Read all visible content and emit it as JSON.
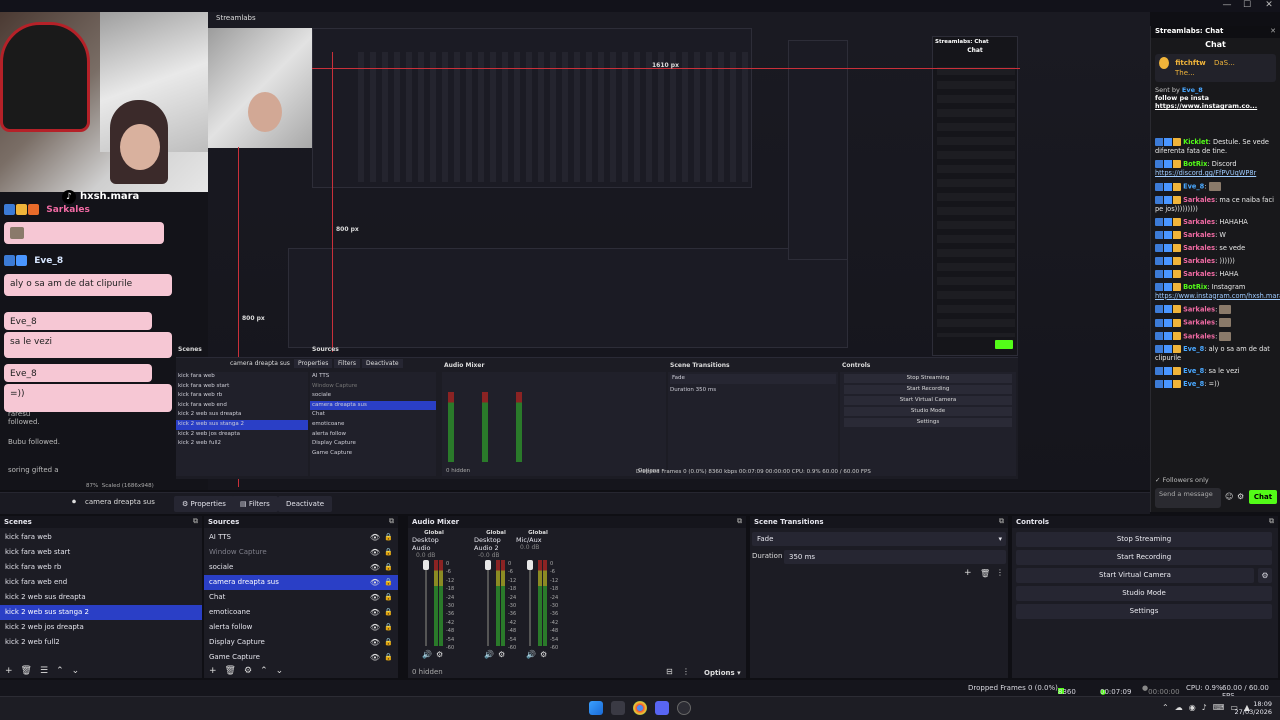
{
  "window": {
    "minimize": "—",
    "maximize": "☐",
    "close": "✕"
  },
  "preview": {
    "tiktok_handle": "hxsh.mara",
    "overlay_bubbles": [
      {
        "user": "Sarkales",
        "text": ""
      },
      {
        "user": "Eve_8",
        "text": "aly o sa am de dat clipurile"
      },
      {
        "user": "Eve_8",
        "text": "sa le vezi"
      },
      {
        "user": "Eve_8",
        "text": "=))"
      }
    ],
    "follow_alerts": [
      "raresu followed.",
      "Bubu followed.",
      "soring gifted a"
    ],
    "nested_title": "Streamlabs",
    "nested_px_a": "1610 px",
    "nested_px_b": "800 px",
    "nested_px_c": "800 px",
    "nested_chat_title": "Streamlabs: Chat",
    "nested_chat_sub": "Chat",
    "mini_scenes": [
      "kick fara web",
      "kick fara web start",
      "kick fara web rb",
      "kick fara web end",
      "kick 2 web sus dreapta",
      "kick 2 web sus stanga 2",
      "kick 2 web jos dreapta",
      "kick 2 web full2"
    ],
    "mini_sources": [
      "AI TTS",
      "Window Capture",
      "sociale",
      "camera dreapta sus",
      "Chat",
      "emoticoane",
      "alerta follow",
      "Display Capture",
      "Game Capture"
    ],
    "mini_headers": {
      "scenes": "Scenes",
      "sources": "Sources",
      "mixer": "Audio Mixer",
      "transitions": "Scene Transitions",
      "controls": "Controls"
    },
    "mini_controls": [
      "Stop Streaming",
      "Start Recording",
      "Start Virtual Camera",
      "Studio Mode",
      "Settings"
    ],
    "mini_transition": "Fade",
    "mini_duration_label": "Duration",
    "mini_duration": "350 ms",
    "mini_selected_source": "camera dreapta sus",
    "mini_props": "Properties",
    "mini_filters": "Filters",
    "mini_deactivate": "Deactivate",
    "mini_hidden": "0 hidden",
    "mini_options": "Options",
    "mini_zoom": "87%",
    "mini_scaled": "Scaled (1686x948)",
    "mini_status": "Dropped Frames 0 (0.0%)   8360 kbps   00:07:09   00:00:00   CPU: 0.9%   60.00 / 60.00 FPS"
  },
  "chat": {
    "panel_title": "Streamlabs: Chat",
    "title": "Chat",
    "pinned_user": "fitchftw",
    "pinned_lines": [
      "DaS...",
      "The..."
    ],
    "pinned_sent_by": "Sent by",
    "pinned_sent_user": "Eve_8",
    "pinned_msg": "follow pe insta",
    "pinned_link": "https://www.instagram.co...",
    "messages": [
      {
        "user": "Kicklet",
        "color": "#53fc18",
        "text": "Destule. Se vede diferenta fata de tine.",
        "link": ""
      },
      {
        "user": "BotRix",
        "color": "#53fc18",
        "text": "Discord",
        "link": "https://discord.gg/FfPVUqWP8r"
      },
      {
        "user": "Eve_8",
        "color": "#4aa8ff",
        "text": "",
        "link": ""
      },
      {
        "user": "Sarkales",
        "color": "#f06aa3",
        "text": "ma ce naiba faci pe jos)))))))))",
        "link": ""
      },
      {
        "user": "Sarkales",
        "color": "#f06aa3",
        "text": "HAHAHA",
        "link": ""
      },
      {
        "user": "Sarkales",
        "color": "#f06aa3",
        "text": "W",
        "link": ""
      },
      {
        "user": "Sarkales",
        "color": "#f06aa3",
        "text": "se vede",
        "link": ""
      },
      {
        "user": "Sarkales",
        "color": "#f06aa3",
        "text": "))))))",
        "link": ""
      },
      {
        "user": "Sarkales",
        "color": "#f06aa3",
        "text": "HAHA",
        "link": ""
      },
      {
        "user": "BotRix",
        "color": "#53fc18",
        "text": "Instagram",
        "link": "https://www.instagram.com/hxsh.mara/"
      },
      {
        "user": "Sarkales",
        "color": "#f06aa3",
        "text": "",
        "link": ""
      },
      {
        "user": "Sarkales",
        "color": "#f06aa3",
        "text": "",
        "link": ""
      },
      {
        "user": "Sarkales",
        "color": "#f06aa3",
        "text": "",
        "link": ""
      },
      {
        "user": "Eve_8",
        "color": "#4aa8ff",
        "text": "aly o sa am de dat clipurile",
        "link": ""
      },
      {
        "user": "Eve_8",
        "color": "#4aa8ff",
        "text": "sa le vezi",
        "link": ""
      },
      {
        "user": "Eve_8",
        "color": "#4aa8ff",
        "text": "=))",
        "link": ""
      }
    ],
    "followers_only": "Followers only",
    "input_placeholder": "Send a message",
    "send_label": "Chat"
  },
  "source_bar": {
    "selected_source": "camera dreapta sus",
    "properties": "Properties",
    "filters": "Filters",
    "deactivate": "Deactivate"
  },
  "scenes": {
    "title": "Scenes",
    "items": [
      {
        "label": "kick fara web",
        "selected": false
      },
      {
        "label": "kick fara web start",
        "selected": false
      },
      {
        "label": "kick fara web rb",
        "selected": false
      },
      {
        "label": "kick fara web end",
        "selected": false
      },
      {
        "label": "kick 2 web sus dreapta",
        "selected": false
      },
      {
        "label": "kick 2 web sus stanga 2",
        "selected": true
      },
      {
        "label": "kick 2 web jos dreapta",
        "selected": false
      },
      {
        "label": "kick 2 web full2",
        "selected": false
      }
    ]
  },
  "sources": {
    "title": "Sources",
    "items": [
      {
        "label": "AI TTS",
        "selected": false,
        "dim": false
      },
      {
        "label": "Window Capture",
        "selected": false,
        "dim": true
      },
      {
        "label": "sociale",
        "selected": false,
        "dim": false
      },
      {
        "label": "camera dreapta sus",
        "selected": true,
        "dim": false
      },
      {
        "label": "Chat",
        "selected": false,
        "dim": false
      },
      {
        "label": "emoticoane",
        "selected": false,
        "dim": false
      },
      {
        "label": "alerta follow",
        "selected": false,
        "dim": false
      },
      {
        "label": "Display Capture",
        "selected": false,
        "dim": false
      },
      {
        "label": "Game Capture",
        "selected": false,
        "dim": false
      }
    ]
  },
  "mixer": {
    "title": "Audio Mixer",
    "channels": [
      {
        "global": "Global",
        "label": "Desktop Audio",
        "db": "0.0 dB"
      },
      {
        "global": "Global",
        "label": "Desktop Audio 2",
        "db": "-0.0 dB"
      },
      {
        "global": "Global",
        "label": "Mic/Aux",
        "db": "0.0 dB"
      }
    ],
    "ticks": [
      "0",
      "-6",
      "-12",
      "-18",
      "-24",
      "-30",
      "-36",
      "-42",
      "-48",
      "-54",
      "-60"
    ],
    "hidden": "0 hidden",
    "options": "Options"
  },
  "transitions": {
    "title": "Scene Transitions",
    "selected": "Fade",
    "duration_label": "Duration",
    "duration": "350 ms"
  },
  "controls": {
    "title": "Controls",
    "buttons": [
      "Stop Streaming",
      "Start Recording",
      "Start Virtual Camera",
      "Studio Mode",
      "Settings"
    ]
  },
  "status": {
    "dropped": "Dropped Frames 0 (0.0%)",
    "kbps": "8360 kbps",
    "stream_time": "00:07:09",
    "rec_time": "00:00:00",
    "cpu": "CPU: 0.9%",
    "fps": "60.00 / 60.00 FPS"
  },
  "taskbar": {
    "time": "18:09",
    "date": "27/03/2026"
  },
  "colors": {
    "accent": "#2a3fc6",
    "kick_green": "#53fc18",
    "overlay_pink": "#f6c7d4",
    "alert_red": "#c9303a"
  }
}
